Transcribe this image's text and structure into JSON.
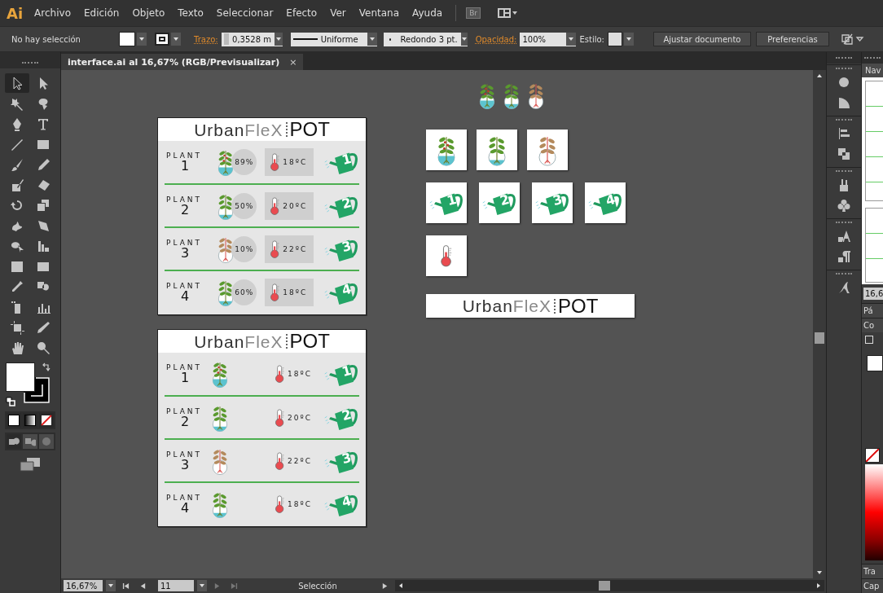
{
  "menu_bar": {
    "app_logo": "Ai",
    "items": [
      "Archivo",
      "Edición",
      "Objeto",
      "Texto",
      "Seleccionar",
      "Efecto",
      "Ver",
      "Ventana",
      "Ayuda"
    ],
    "bridge_button": "Br"
  },
  "control_bar": {
    "selection_status": "No hay selección",
    "stroke_label": "Trazo:",
    "stroke_weight": "0,3528 m",
    "stroke_profile": "Uniforme",
    "brush": "Redondo 3 pt.",
    "opacity_label": "Opacidad:",
    "opacity": "100%",
    "style_label": "Estilo:",
    "buttons": [
      "Ajustar documento",
      "Preferencias"
    ]
  },
  "document_tab": {
    "title": "interface.ai al 16,67% (RGB/Previsualizar)",
    "close": "×"
  },
  "tools": [
    {
      "selected": true
    },
    {
      "selected": false
    },
    {
      "selected": false
    },
    {
      "selected": false
    },
    {
      "selected": false
    },
    {
      "selected": false
    },
    {
      "selected": false
    },
    {
      "selected": false
    },
    {
      "selected": false
    },
    {
      "selected": false
    },
    {
      "selected": false
    },
    {
      "selected": false
    },
    {
      "selected": false
    },
    {
      "selected": false
    },
    {
      "selected": false
    },
    {
      "selected": false
    },
    {
      "selected": false
    },
    {
      "selected": false
    },
    {
      "selected": false
    },
    {
      "selected": false
    },
    {
      "selected": false
    },
    {
      "selected": false
    },
    {
      "selected": false
    },
    {
      "selected": false
    },
    {
      "selected": false
    },
    {
      "selected": false
    },
    {
      "selected": false
    },
    {
      "selected": false
    }
  ],
  "artboards": [
    {
      "kind": "detailed",
      "logo": {
        "urban": "Urban",
        "flex": "FleX",
        "pot": "POT"
      },
      "rows": [
        {
          "label": "PLANT",
          "number": "1",
          "kind": "berries",
          "humidity": "89%",
          "temperature": "18ºC",
          "can_number": "1"
        },
        {
          "label": "PLANT",
          "number": "2",
          "kind": "leafy",
          "humidity": "50%",
          "temperature": "20ºC",
          "can_number": "2"
        },
        {
          "label": "PLANT",
          "number": "3",
          "kind": "withered",
          "humidity": "10%",
          "temperature": "22ºC",
          "can_number": "3"
        },
        {
          "label": "PLANT",
          "number": "4",
          "kind": "leafy",
          "humidity": "60%",
          "temperature": "18ºC",
          "can_number": "4"
        }
      ]
    },
    {
      "kind": "simple",
      "logo": {
        "urban": "Urban",
        "flex": "FleX",
        "pot": "POT"
      },
      "rows": [
        {
          "label": "PLANT",
          "number": "1",
          "kind": "berries",
          "temperature": "18ºC",
          "can_number": "1"
        },
        {
          "label": "PLANT",
          "number": "2",
          "kind": "leafy",
          "temperature": "20ºC",
          "can_number": "2"
        },
        {
          "label": "PLANT",
          "number": "3",
          "kind": "withered",
          "temperature": "22ºC",
          "can_number": "3"
        },
        {
          "label": "PLANT",
          "number": "4",
          "kind": "leafy",
          "temperature": "18ºC",
          "can_number": "4"
        }
      ]
    }
  ],
  "assets": {
    "top_plants": [
      {
        "kind": "berries"
      },
      {
        "kind": "leafy"
      },
      {
        "kind": "withered"
      }
    ],
    "tile_rows": [
      [
        {
          "kind": "berries"
        },
        {
          "kind": "leafy"
        },
        {
          "kind": "withered"
        }
      ],
      [
        {
          "kind": "can",
          "number": "1"
        },
        {
          "kind": "can",
          "number": "2"
        },
        {
          "kind": "can",
          "number": "3"
        },
        {
          "kind": "can",
          "number": "4"
        }
      ],
      [
        {
          "kind": "thermometer"
        }
      ]
    ],
    "banner": {
      "urban": "Urban",
      "flex": "FleX",
      "pot": "POT"
    }
  },
  "right_panel": {
    "navigator_tab": "Nav",
    "zoom_value": "16,6",
    "pages_header": "Pá",
    "color_header": "Co",
    "transparency_header": "Tra",
    "layers_header": "Cap"
  },
  "status_bar": {
    "zoom": "16,67%",
    "artboard": "11",
    "tool": "Selección"
  }
}
